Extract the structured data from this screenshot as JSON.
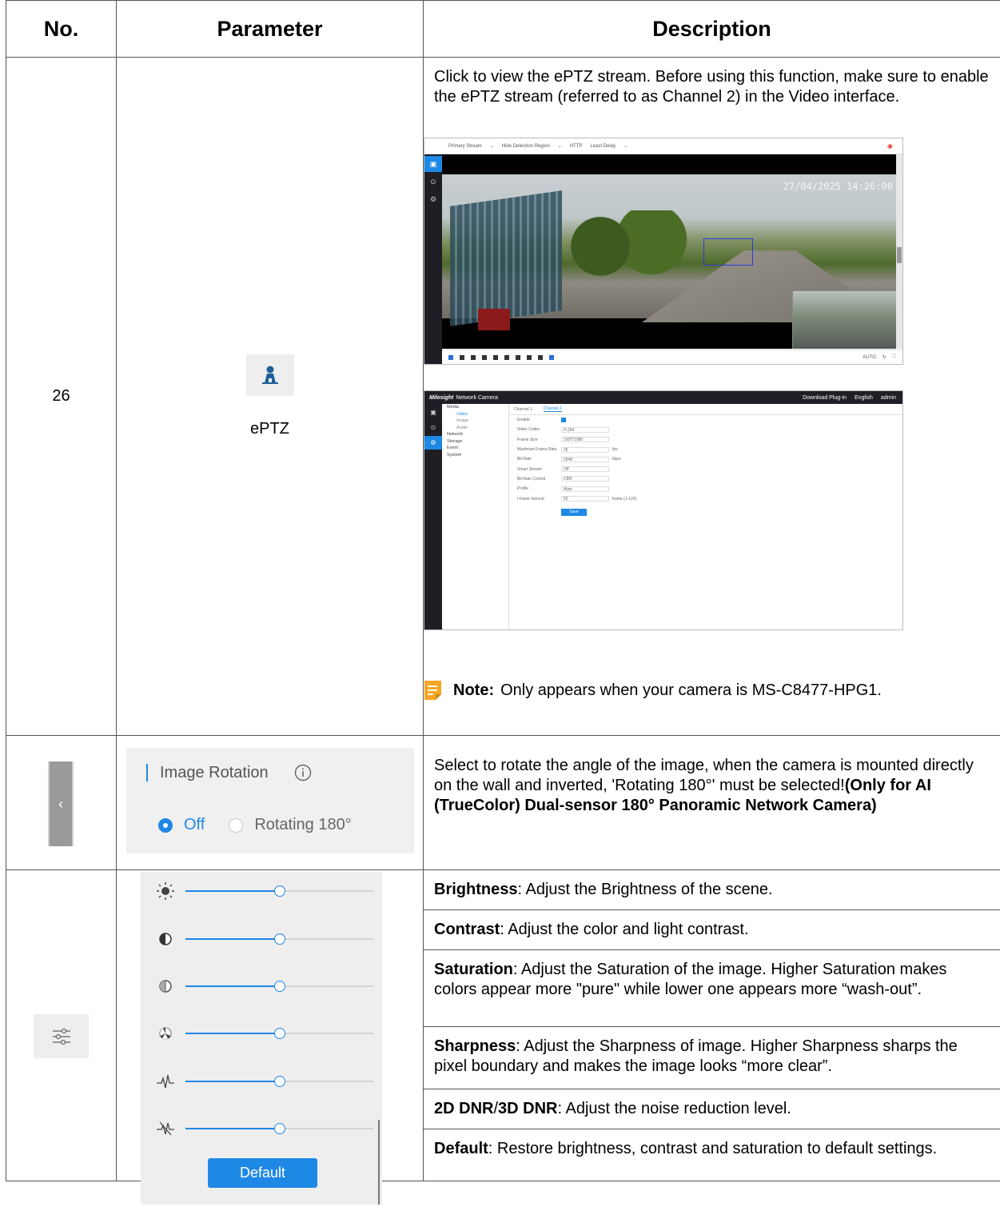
{
  "table": {
    "headers": {
      "no": "No.",
      "parameter": "Parameter",
      "description": "Description"
    }
  },
  "row_eptz": {
    "number": "26",
    "param_label": "ePTZ",
    "icon": "eptz-person-icon",
    "description": "Click to view the ePTZ stream. Before using this function, make sure to enable the ePTZ stream (referred to as Channel 2) in the Video interface.",
    "note_label": "Note:",
    "note_text": "Only appears when your camera is MS-C8477-HPG1.",
    "screenshot1": {
      "stream": "Primary Stream",
      "region": "Hide Detection Region",
      "protocol": "HTTP",
      "delay": "Least Delay",
      "timestamp": "27/04/2025 14:26:00",
      "mode": "AUTO"
    },
    "screenshot2": {
      "brand": "Milesight",
      "app_title": "Network Camera",
      "download": "Download Plug-in",
      "language": "English",
      "user": "admin",
      "menu": [
        "Media",
        "Video",
        "Image",
        "Audio",
        "Network",
        "Storage",
        "Event",
        "System"
      ],
      "tabs": [
        "Channel 1",
        "Channel 2"
      ],
      "fields": [
        {
          "label": "Enable",
          "value": ""
        },
        {
          "label": "Video Codec",
          "value": "H.264"
        },
        {
          "label": "Frame Size",
          "value": "1920*1080"
        },
        {
          "label": "Maximum Frame Rate",
          "value": "25",
          "unit": "fps"
        },
        {
          "label": "Bit Rate",
          "value": "2048",
          "unit": "kbps"
        },
        {
          "label": "Smart Stream",
          "value": "Off"
        },
        {
          "label": "Bit Rate Control",
          "value": "CBR"
        },
        {
          "label": "Profile",
          "value": "Main"
        },
        {
          "label": "I-frame Interval",
          "value": "50",
          "unit": "frame (1-120)"
        }
      ],
      "save": "Save"
    }
  },
  "row_rotation": {
    "panel_title": "Image Rotation",
    "option_off": "Off",
    "option_rotating": "Rotating 180°",
    "selected": "Off",
    "collapse_icon": "chevron-left-icon",
    "description": "Select to rotate the angle of the image, when the camera is mounted directly on the wall and inverted, 'Rotating 180°' must be selected!",
    "description_bold": "(Only for AI (TrueColor) Dual-sensor 180° Panoramic Network Camera)"
  },
  "row_image": {
    "icon": "sliders-adjust-icon",
    "sliders": [
      {
        "name": "brightness",
        "icon": "sun-icon",
        "level": 0.5
      },
      {
        "name": "contrast",
        "icon": "contrast-icon",
        "level": 0.5
      },
      {
        "name": "saturation",
        "icon": "saturation-icon",
        "level": 0.5
      },
      {
        "name": "sharpness",
        "icon": "aperture-icon",
        "level": 0.5
      },
      {
        "name": "dnr-2d",
        "icon": "waveform-icon",
        "level": 0.5
      },
      {
        "name": "dnr-3d",
        "icon": "noise-icon",
        "level": 0.5
      }
    ],
    "default_button": "Default",
    "descriptions": [
      {
        "term": "Brightness",
        "text": ": Adjust the Brightness of the scene."
      },
      {
        "term": "Contrast",
        "text": ": Adjust the color and light contrast."
      },
      {
        "term": "Saturation",
        "text": ": Adjust the Saturation of the image. Higher Saturation makes colors appear more \"pure\" while lower one appears more “wash-out”."
      },
      {
        "term": "Sharpness",
        "text": ": Adjust the Sharpness of image. Higher Sharpness sharps the pixel boundary and makes the image looks “more clear”."
      },
      {
        "term": "2D DNR",
        "sep": "/",
        "term2": "3D DNR",
        "text": ": Adjust the noise reduction level."
      },
      {
        "term": "Default",
        "text": ": Restore brightness, contrast and saturation to default settings."
      }
    ]
  },
  "colors": {
    "accent": "#1e88e5",
    "panel_bg": "#eeeeee",
    "note_icon": "#f5a623"
  }
}
